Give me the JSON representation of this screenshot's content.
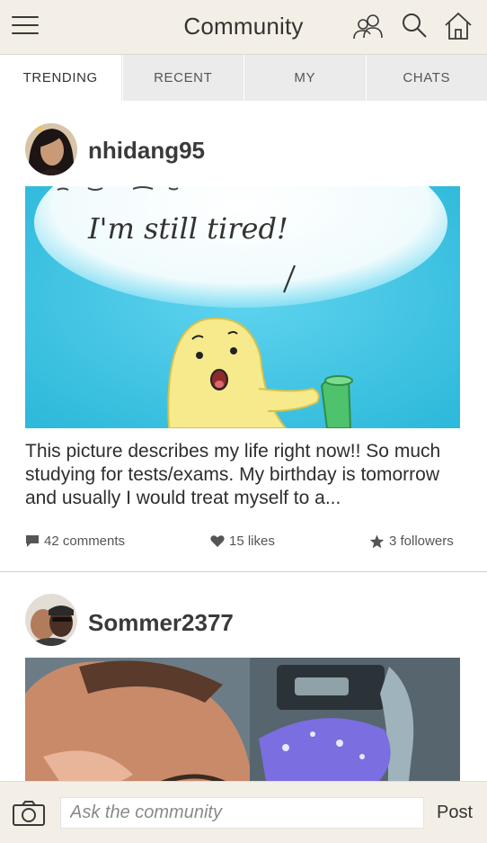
{
  "header": {
    "menu_icon": "hamburger-menu-icon",
    "title": "Community",
    "icons": [
      "members-icon",
      "search-icon",
      "home-icon"
    ]
  },
  "tabs": [
    {
      "label": "TRENDING",
      "active": true
    },
    {
      "label": "RECENT",
      "active": false
    },
    {
      "label": "MY",
      "active": false
    },
    {
      "label": "CHATS",
      "active": false
    }
  ],
  "posts": [
    {
      "username": "nhidang95",
      "image_caption": {
        "line1": "I'm  still  tired!",
        "line2": "/"
      },
      "text": "This picture describes my life right now!! So much studying for tests/exams. My birthday is tomorrow and usually I would treat myself to a...",
      "comments": "42 comments",
      "likes": "15 likes",
      "followers": "3 followers"
    },
    {
      "username": "Sommer2377"
    }
  ],
  "composer": {
    "camera_icon": "camera-icon",
    "placeholder": "Ask the community",
    "post_label": "Post"
  },
  "colors": {
    "bar_background": "#f3efe6",
    "tab_background": "#ebebeb",
    "image_sky": "#35c2e2",
    "text_dark": "#333333"
  }
}
